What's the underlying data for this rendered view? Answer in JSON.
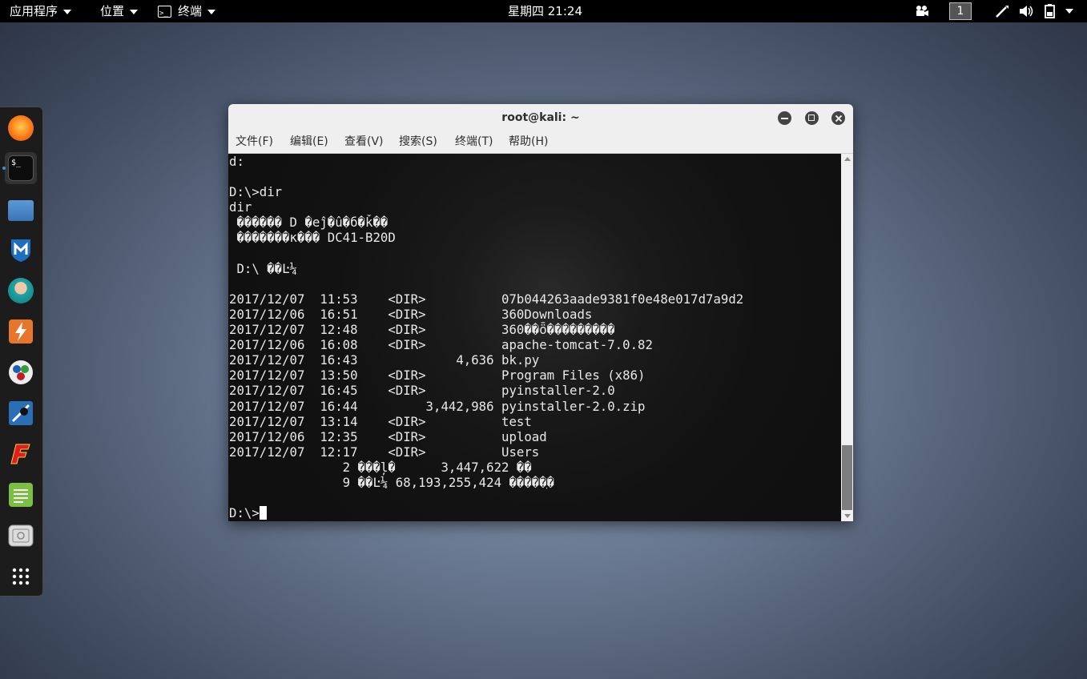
{
  "topbar": {
    "apps_label": "应用程序",
    "places_label": "位置",
    "terminal_label": "终端",
    "clock": "星期四 21:24",
    "workspace": "1"
  },
  "dock": {
    "items": [
      "firefox-icon",
      "terminal-icon",
      "files-icon",
      "metasploit-icon",
      "armitage-icon",
      "burpsuite-icon",
      "maltego-icon",
      "beef-icon",
      "faraday-icon",
      "text-editor-icon",
      "screenshot-icon",
      "app-grid-icon"
    ]
  },
  "window": {
    "title": "root@kali: ~",
    "menu": [
      "文件(F)",
      "编辑(E)",
      "查看(V)",
      "搜索(S)",
      "终端(T)",
      "帮助(H)"
    ]
  },
  "terminal": {
    "lines": [
      "d:",
      "",
      "D:\\>dir",
      "dir",
      " ������ D �еĵ�û�б�ǩ��",
      " �������к��� DC41-B20D",
      "",
      " D:\\ ��Ŀ¼",
      "",
      "2017/12/07  11:53    <DIR>          07b044263aade9381f0e48e017d7a9d2",
      "2017/12/06  16:51    <DIR>          360Downloads",
      "2017/12/07  12:48    <DIR>          360��ȫ���������",
      "2017/12/06  16:08    <DIR>          apache-tomcat-7.0.82",
      "2017/12/07  16:43             4,636 bk.py",
      "2017/12/07  13:50    <DIR>          Program Files (x86)",
      "2017/12/07  16:45    <DIR>          pyinstaller-2.0",
      "2017/12/07  16:44         3,442,986 pyinstaller-2.0.zip",
      "2017/12/07  13:14    <DIR>          test",
      "2017/12/06  12:35    <DIR>          upload",
      "2017/12/07  12:17    <DIR>          Users",
      "               2 ���ļ�      3,447,622 ��",
      "               9 ��Ŀ¼ 68,193,255,424 �����ֽ�",
      ""
    ],
    "prompt": "D:\\>"
  },
  "colors": {
    "topbar_bg": "#000000",
    "terminal_bg": "#111111",
    "terminal_fg": "#e8e8e8",
    "titlebar_bg": "#efefef",
    "dock_running_dot": "#3d8fd9"
  }
}
